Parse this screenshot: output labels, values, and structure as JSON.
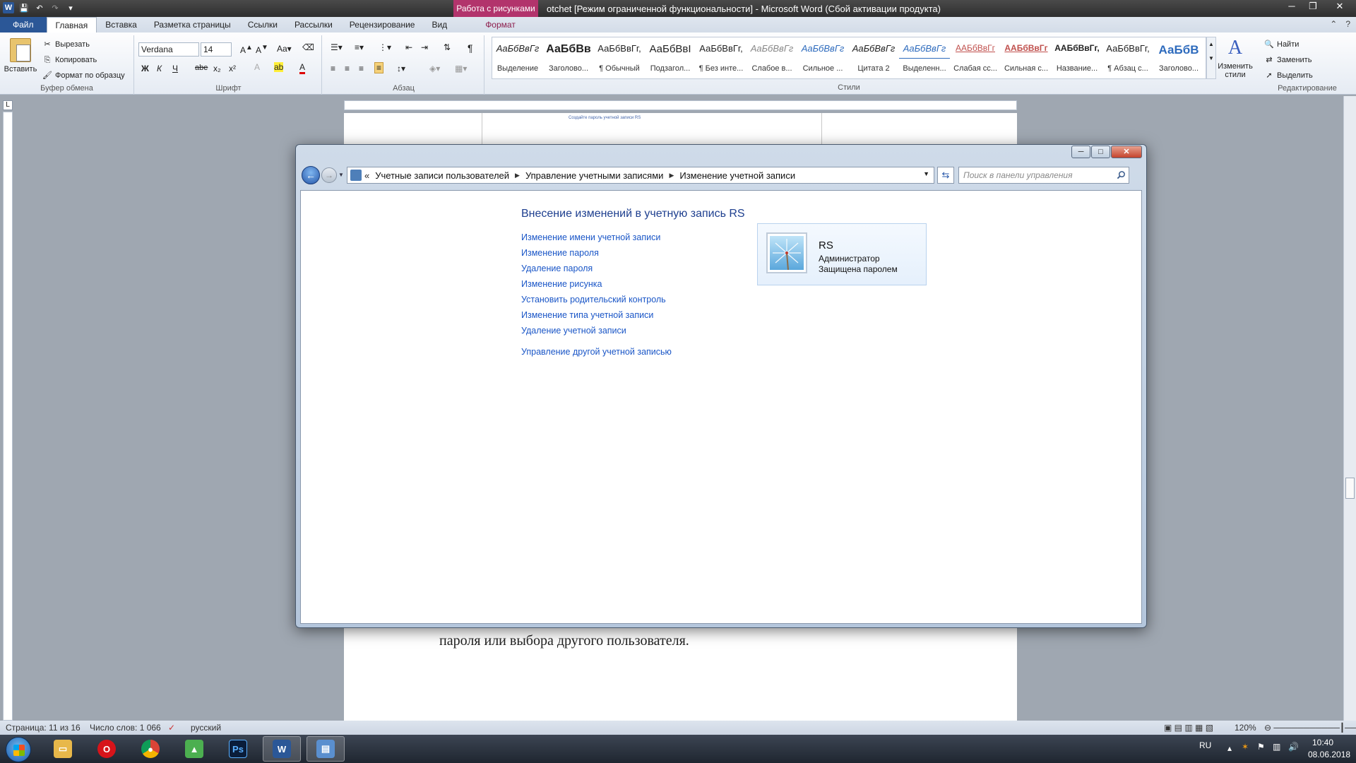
{
  "word": {
    "title": "otchet [Режим ограниченной функциональности]  -  Microsoft Word (Сбой активации продукта)",
    "context_tab_header": "Работа с рисунками",
    "tabs": [
      "Файл",
      "Главная",
      "Вставка",
      "Разметка страницы",
      "Ссылки",
      "Рассылки",
      "Рецензирование",
      "Вид",
      "Формат"
    ],
    "clipboard": {
      "paste": "Вставить",
      "cut": "Вырезать",
      "copy": "Копировать",
      "format_painter": "Формат по образцу",
      "group": "Буфер обмена"
    },
    "font": {
      "name": "Verdana",
      "size": "14",
      "group": "Шрифт",
      "bold": "Ж",
      "italic": "К",
      "underline": "Ч",
      "strike": "abe",
      "sub": "x₂",
      "sup": "x²"
    },
    "paragraph": {
      "group": "Абзац",
      "pilcrow": "¶"
    },
    "styles": {
      "group": "Стили",
      "items": [
        {
          "sample": "АаБбВвГг",
          "name": "Выделение"
        },
        {
          "sample": "АаБбВв",
          "name": "Заголово..."
        },
        {
          "sample": "АаБбВвГг,",
          "name": "¶ Обычный"
        },
        {
          "sample": "АаБбВвI",
          "name": "Подзагол..."
        },
        {
          "sample": "АаБбВвГг,",
          "name": "¶ Без инте..."
        },
        {
          "sample": "АаБбВвГг",
          "name": "Слабое в..."
        },
        {
          "sample": "АаБбВвГг",
          "name": "Сильное ..."
        },
        {
          "sample": "АаБбВвГг",
          "name": "Цитата 2"
        },
        {
          "sample": "АаБбВвГг",
          "name": "Выделенн..."
        },
        {
          "sample": "ААБбВвГг",
          "name": "Слабая сс..."
        },
        {
          "sample": "ААБбВвГг",
          "name": "Сильная с..."
        },
        {
          "sample": "ААБбВвГг,",
          "name": "Название..."
        },
        {
          "sample": "АаБбВвГг,",
          "name": "¶ Абзац с..."
        },
        {
          "sample": "АаБбВ",
          "name": "Заголово..."
        }
      ],
      "change_styles": "Изменить стили"
    },
    "editing": {
      "group": "Редактирование",
      "find": "Найти",
      "replace": "Заменить",
      "select": "Выделить"
    },
    "document_text": "пароля или выбора другого пользователя.",
    "thumb_text": "Создайте пароль учетной записи RS",
    "status": {
      "page": "Страница: 11 из 16",
      "words": "Число слов: 1 066",
      "lang": "русский",
      "zoom": "120%"
    }
  },
  "control_panel": {
    "breadcrumbs": [
      "Учетные записи пользователей",
      "Управление учетными записями",
      "Изменение учетной записи"
    ],
    "breadcrumb_prefix": "«",
    "search_placeholder": "Поиск в панели управления",
    "heading": "Внесение изменений в учетную запись RS",
    "links": [
      "Изменение имени учетной записи",
      "Изменение пароля",
      "Удаление пароля",
      "Изменение рисунка",
      "Установить родительский контроль",
      "Изменение типа учетной записи",
      "Удаление учетной записи"
    ],
    "other_account_link": "Управление другой учетной записью",
    "user": {
      "name": "RS",
      "role": "Администратор",
      "status": "Защищена паролем"
    }
  },
  "taskbar": {
    "lang": "RU",
    "time": "10:40",
    "date": "08.06.2018",
    "ps_label": "Ps",
    "word_label": "W"
  },
  "colors": {
    "link": "#1a56c7",
    "heading": "#1e3f8f",
    "word_blue": "#2b5797",
    "context_tab": "#b2346c"
  }
}
